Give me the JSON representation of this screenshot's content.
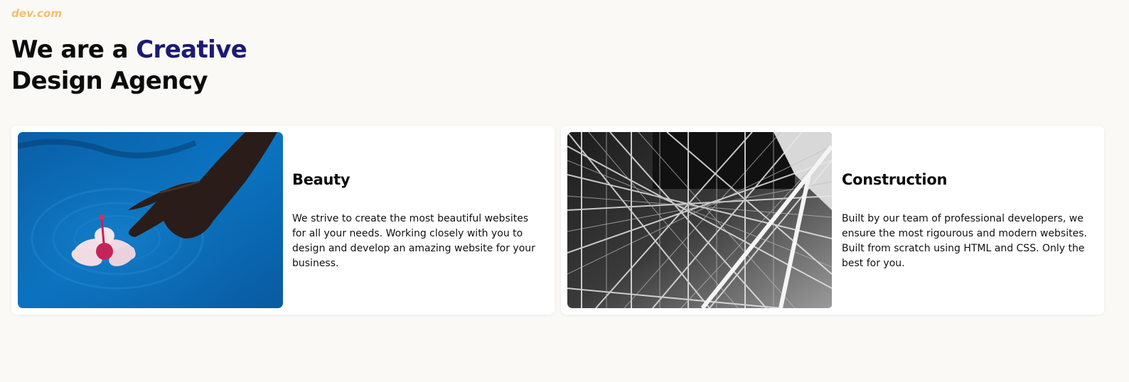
{
  "site": {
    "logo": "dev.com"
  },
  "hero": {
    "title_part1": "We are a ",
    "title_accent": "Creative",
    "title_part2": "Design Agency"
  },
  "cards": [
    {
      "title": "Beauty",
      "text": "We strive to create the most beautiful websites for all your needs. Working closely with you to design and develop an amazing website for your business.",
      "image": "hand-touching-water-with-flower"
    },
    {
      "title": "Construction",
      "text": "Built by our team of professional developers, we ensure the most rigourous and modern websites. Built from scratch using HTML and CSS. Only the best for you.",
      "image": "steel-scaffold-structure-black-and-white"
    }
  ],
  "colors": {
    "background": "#faf9f6",
    "logo": "#f6bd6b",
    "accent": "#1c1a72",
    "card": "#ffffff"
  }
}
